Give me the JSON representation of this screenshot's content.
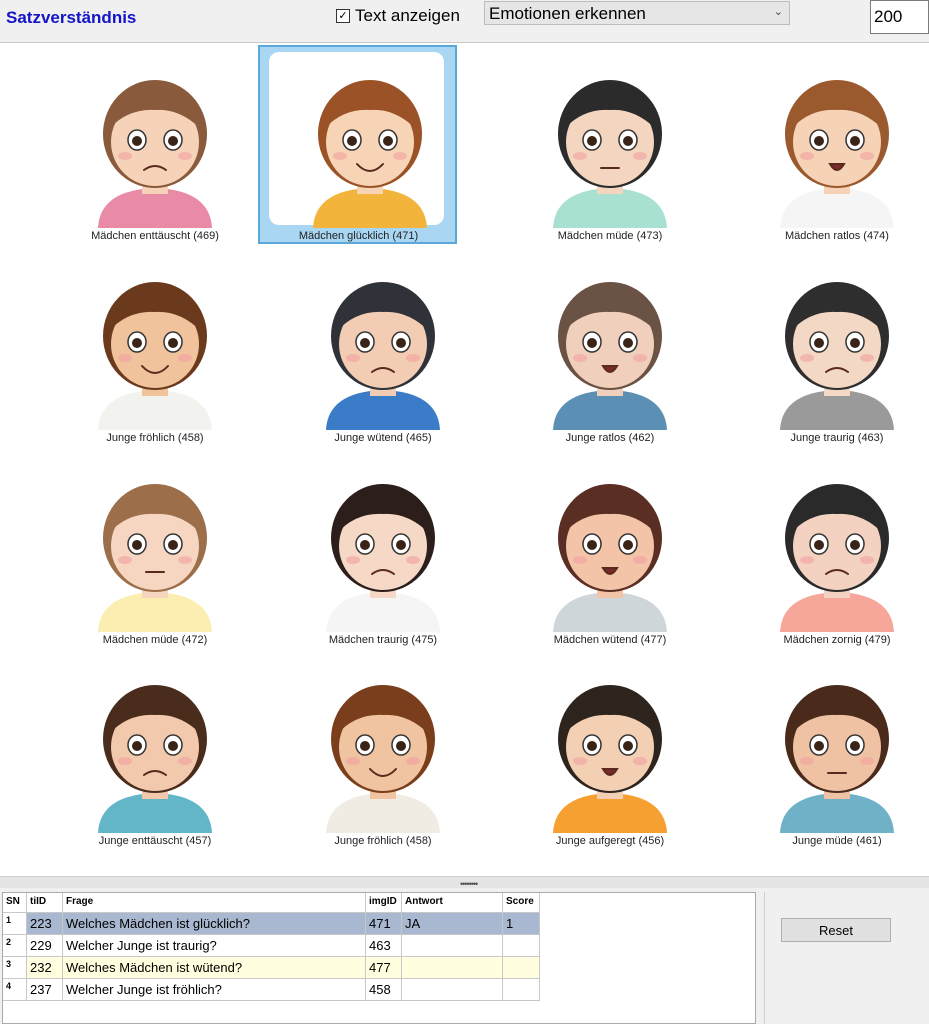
{
  "toolbar": {
    "title": "Satzverständnis",
    "show_text_label": "Text anzeigen",
    "show_text_checked": "✓",
    "mode_selected": "Emotionen erkennen",
    "size_value": "200"
  },
  "tiles": [
    {
      "caption": "Mädchen enttäuscht (469)",
      "hair": "#8a5a3c",
      "skin": "#f6d3b8",
      "shirt": "#e98aa6",
      "mouth": "frown"
    },
    {
      "caption": "Mädchen glücklich (471)",
      "hair": "#9a5226",
      "skin": "#f7d4b6",
      "shirt": "#f2b43a",
      "mouth": "smile"
    },
    {
      "caption": "Mädchen müde (473)",
      "hair": "#2b2b2b",
      "skin": "#f4d6c0",
      "shirt": "#a8e0d2",
      "mouth": "flat"
    },
    {
      "caption": "Mädchen ratlos (474)",
      "hair": "#9a5a2e",
      "skin": "#f6d2b6",
      "shirt": "#f5f5f5",
      "mouth": "open"
    },
    {
      "caption": "Junge fröhlich (458)",
      "hair": "#6b3a1c",
      "skin": "#f1c39c",
      "shirt": "#f2f2ee",
      "mouth": "smile"
    },
    {
      "caption": "Junge wütend (465)",
      "hair": "#2f3238",
      "skin": "#f2cdb4",
      "shirt": "#3a7cc8",
      "mouth": "frown"
    },
    {
      "caption": "Junge ratlos (462)",
      "hair": "#6a5244",
      "skin": "#f0d0bc",
      "shirt": "#5b8fb4",
      "mouth": "open"
    },
    {
      "caption": "Junge traurig (463)",
      "hair": "#2e2e2e",
      "skin": "#f4d8c6",
      "shirt": "#9a9a9a",
      "mouth": "frown"
    },
    {
      "caption": "Mädchen müde (472)",
      "hair": "#9c6e4a",
      "skin": "#f6d6c0",
      "shirt": "#fbeeb0",
      "mouth": "flat"
    },
    {
      "caption": "Mädchen traurig (475)",
      "hair": "#2c1e1a",
      "skin": "#f6d8c6",
      "shirt": "#f5f5f5",
      "mouth": "frown"
    },
    {
      "caption": "Mädchen wütend (477)",
      "hair": "#5a2e22",
      "skin": "#f3c4a8",
      "shirt": "#cfd6da",
      "mouth": "open"
    },
    {
      "caption": "Mädchen zornig (479)",
      "hair": "#2a2a2a",
      "skin": "#f4d2c2",
      "shirt": "#f6a79a",
      "mouth": "frown"
    },
    {
      "caption": "Junge enttäuscht (457)",
      "hair": "#4a2c1c",
      "skin": "#f2c9ac",
      "shirt": "#62b6c8",
      "mouth": "frown"
    },
    {
      "caption": "Junge fröhlich (458)",
      "hair": "#7a3e1c",
      "skin": "#f0c4a0",
      "shirt": "#f0ece4",
      "mouth": "smile"
    },
    {
      "caption": "Junge aufgeregt (456)",
      "hair": "#2e241e",
      "skin": "#f3cfb4",
      "shirt": "#f5a030",
      "mouth": "open"
    },
    {
      "caption": "Junge müde (461)",
      "hair": "#4a2a1a",
      "skin": "#f0c2a4",
      "shirt": "#6fb2c8",
      "mouth": "flat"
    }
  ],
  "selected_tile": 1,
  "table": {
    "headers": {
      "sn": "SN",
      "tiid": "tiID",
      "frage": "Frage",
      "imgid": "imgID",
      "antwort": "Antwort",
      "score": "Score"
    },
    "rows": [
      {
        "sn": "1",
        "tiid": "223",
        "frage": "Welches Mädchen ist glücklich?",
        "imgid": "471",
        "antwort": "JA",
        "score": "1"
      },
      {
        "sn": "2",
        "tiid": "229",
        "frage": "Welcher Junge ist traurig?",
        "imgid": "463",
        "antwort": "",
        "score": ""
      },
      {
        "sn": "3",
        "tiid": "232",
        "frage": "Welches Mädchen ist wütend?",
        "imgid": "477",
        "antwort": "",
        "score": ""
      },
      {
        "sn": "4",
        "tiid": "237",
        "frage": "Welcher Junge ist fröhlich?",
        "imgid": "458",
        "antwort": "",
        "score": ""
      }
    ]
  },
  "reset_label": "Reset"
}
